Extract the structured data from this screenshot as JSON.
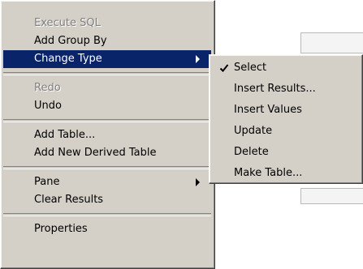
{
  "main_menu": {
    "items": [
      {
        "label": "Execute SQL",
        "disabled": true
      },
      {
        "label": "Add Group By",
        "disabled": false
      },
      {
        "label": "Change Type",
        "disabled": false,
        "submenu": true,
        "highlighted": true
      },
      {
        "label": "Redo",
        "disabled": true
      },
      {
        "label": "Undo",
        "disabled": false
      },
      {
        "label": "Add Table...",
        "disabled": false
      },
      {
        "label": "Add New Derived Table",
        "disabled": false
      },
      {
        "label": "Pane",
        "disabled": false,
        "submenu": true
      },
      {
        "label": "Clear Results",
        "disabled": false
      },
      {
        "label": "Properties",
        "disabled": false
      }
    ]
  },
  "submenu": {
    "items": [
      {
        "label": "Select",
        "checked": true
      },
      {
        "label": "Insert Results..."
      },
      {
        "label": "Insert Values"
      },
      {
        "label": "Update"
      },
      {
        "label": "Delete"
      },
      {
        "label": "Make Table..."
      }
    ]
  },
  "colors": {
    "menu_face": "#d4d0c8",
    "highlight": "#0a246a",
    "disabled_text": "#808080"
  },
  "icons": {
    "check": "check-icon",
    "submenu_arrow": "submenu-arrow-icon"
  }
}
